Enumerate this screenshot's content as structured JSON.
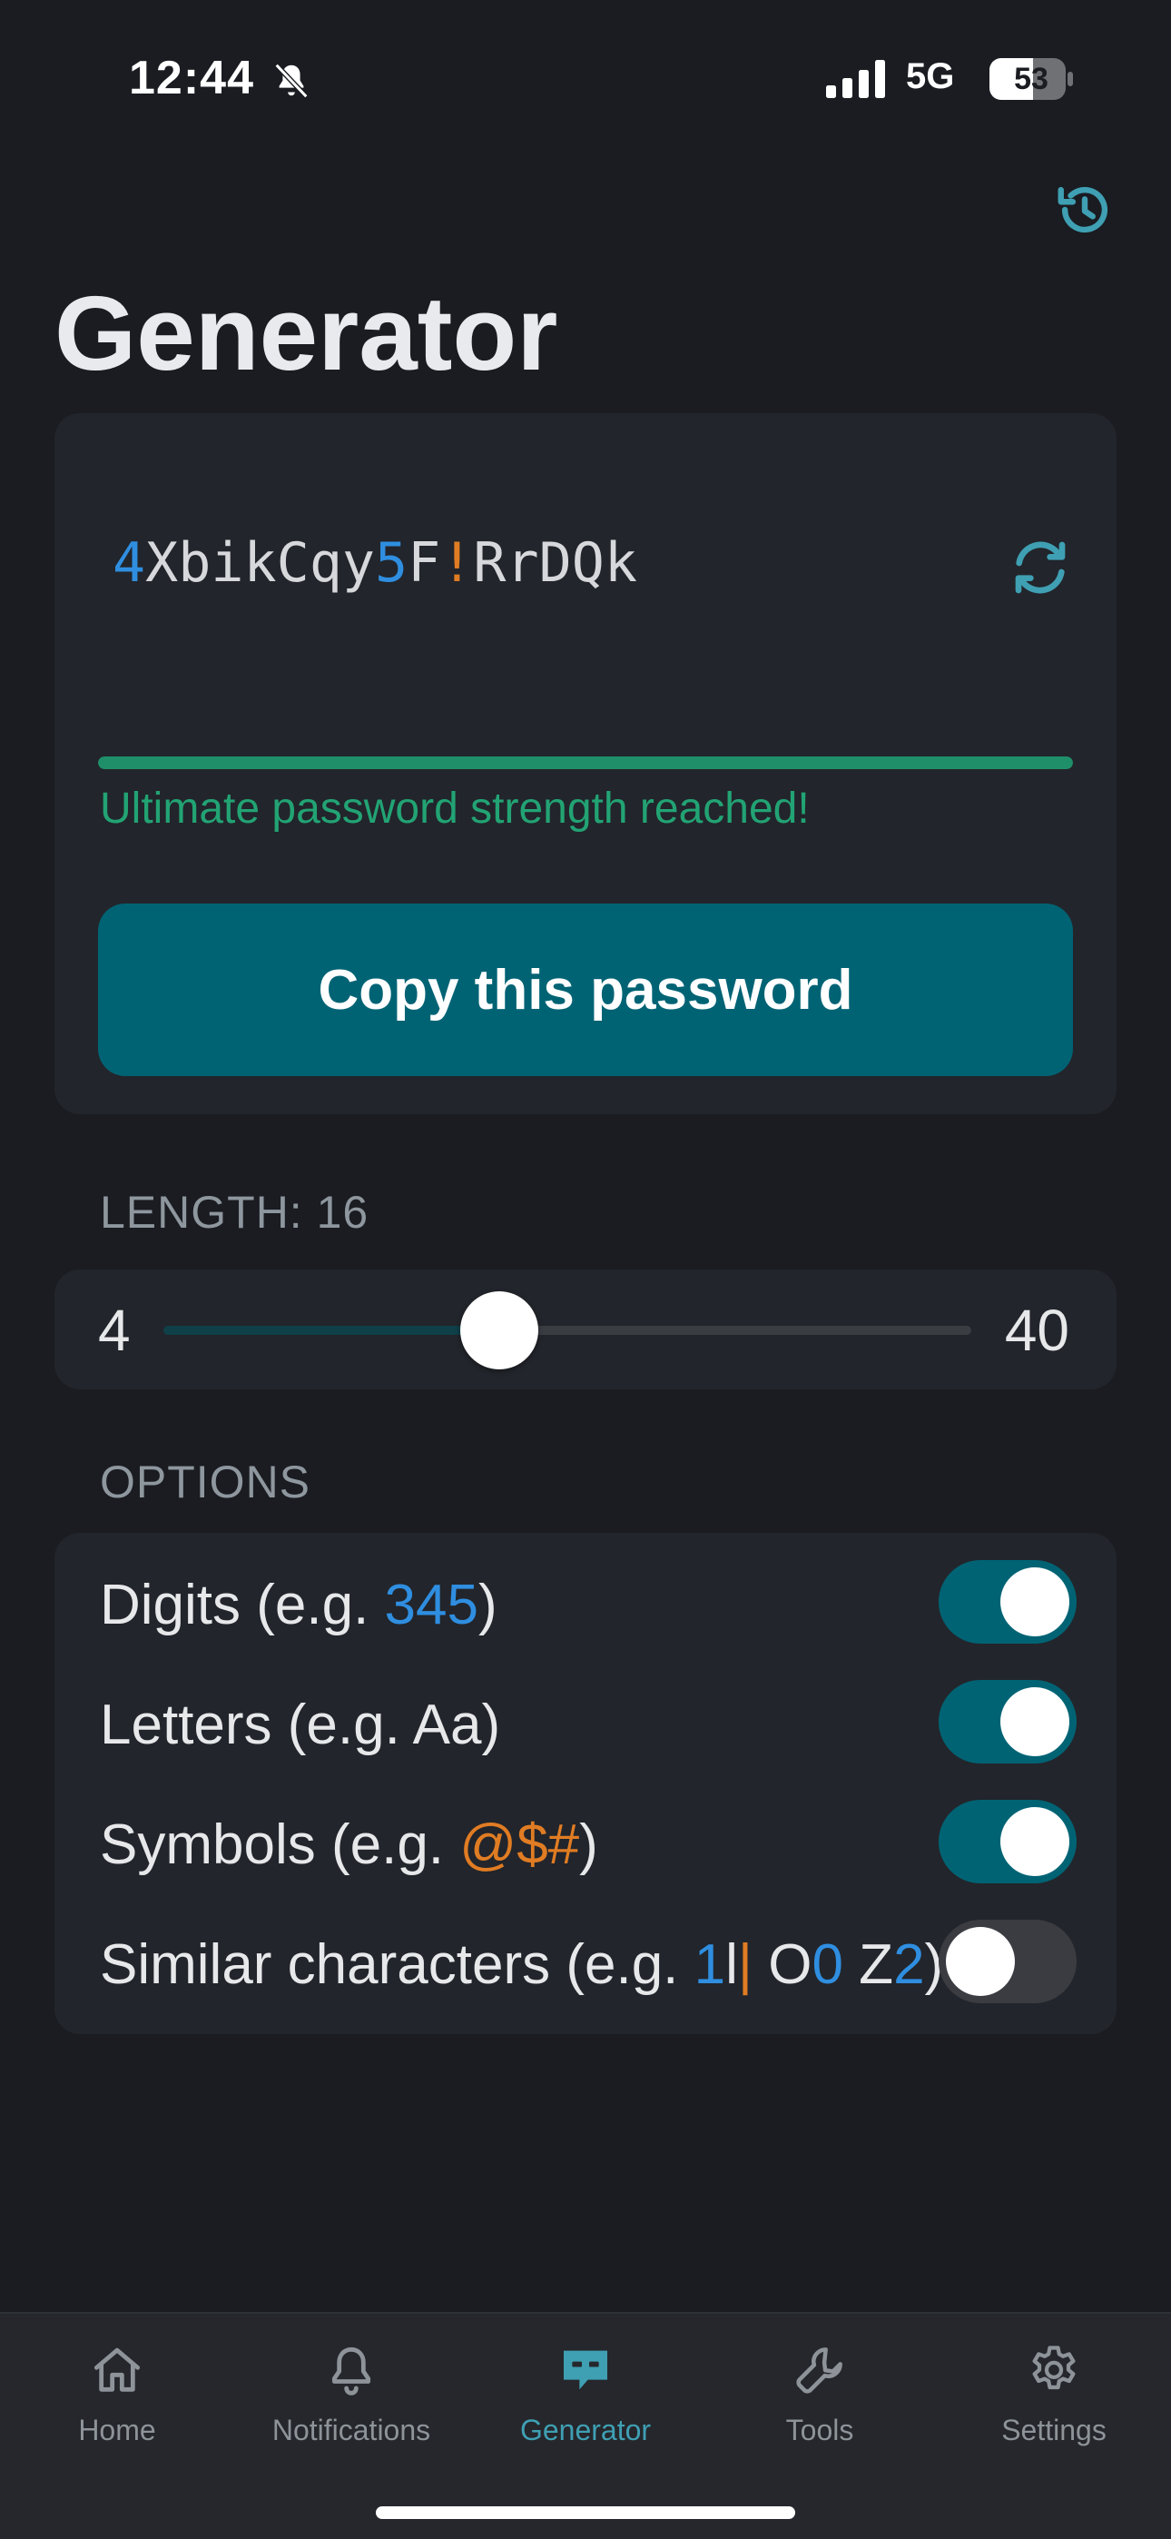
{
  "status_bar": {
    "time": "12:44",
    "network": "5G",
    "battery_level": "53"
  },
  "header": {
    "title": "Generator"
  },
  "password": {
    "characters": [
      {
        "ch": "4",
        "kind": "digit"
      },
      {
        "ch": "X",
        "kind": "letter"
      },
      {
        "ch": "b",
        "kind": "letter"
      },
      {
        "ch": "i",
        "kind": "letter"
      },
      {
        "ch": "k",
        "kind": "letter"
      },
      {
        "ch": "C",
        "kind": "letter"
      },
      {
        "ch": "q",
        "kind": "letter"
      },
      {
        "ch": "y",
        "kind": "letter"
      },
      {
        "ch": "5",
        "kind": "digit"
      },
      {
        "ch": "F",
        "kind": "letter"
      },
      {
        "ch": "!",
        "kind": "symbol"
      },
      {
        "ch": "R",
        "kind": "letter"
      },
      {
        "ch": "r",
        "kind": "letter"
      },
      {
        "ch": "D",
        "kind": "letter"
      },
      {
        "ch": "Q",
        "kind": "letter"
      },
      {
        "ch": "k",
        "kind": "letter"
      }
    ],
    "strength_percent": 100,
    "strength_message": "Ultimate password strength reached!",
    "copy_label": "Copy this password"
  },
  "length": {
    "label": "LENGTH: 16",
    "min_label": "4",
    "max_label": "40",
    "min": 4,
    "max": 40,
    "value": 16
  },
  "options": {
    "label": "OPTIONS",
    "items": [
      {
        "id": "digits",
        "segments": [
          {
            "t": "Digits (e.g. ",
            "k": "text"
          },
          {
            "t": "345",
            "k": "digit"
          },
          {
            "t": ")",
            "k": "text"
          }
        ],
        "enabled": true
      },
      {
        "id": "letters",
        "segments": [
          {
            "t": "Letters (e.g. Aa)",
            "k": "text"
          }
        ],
        "enabled": true
      },
      {
        "id": "symbols",
        "segments": [
          {
            "t": "Symbols (e.g. ",
            "k": "text"
          },
          {
            "t": "@$#",
            "k": "symbol"
          },
          {
            "t": ")",
            "k": "text"
          }
        ],
        "enabled": true
      },
      {
        "id": "similar",
        "segments": [
          {
            "t": "Similar characters (e.g. ",
            "k": "text"
          },
          {
            "t": "1",
            "k": "digit"
          },
          {
            "t": "l",
            "k": "text"
          },
          {
            "t": "|",
            "k": "symbol"
          },
          {
            "t": " O",
            "k": "text"
          },
          {
            "t": "0",
            "k": "digit"
          },
          {
            "t": " Z",
            "k": "text"
          },
          {
            "t": "2",
            "k": "digit"
          },
          {
            "t": ")",
            "k": "text"
          }
        ],
        "enabled": false
      }
    ]
  },
  "tabs": [
    {
      "label": "Home",
      "icon": "house-icon",
      "active": false
    },
    {
      "label": "Notifications",
      "icon": "bell-icon",
      "active": false
    },
    {
      "label": "Generator",
      "icon": "chat-dots-icon",
      "active": true
    },
    {
      "label": "Tools",
      "icon": "wrench-icon",
      "active": false
    },
    {
      "label": "Settings",
      "icon": "gear-icon",
      "active": false
    }
  ],
  "colors": {
    "background": "#1a1c21",
    "card": "#22252b",
    "accent": "#006374",
    "digit": "#2f8ee0",
    "symbol": "#e07c23",
    "strength": "#22a374",
    "active_tab": "#3f9fb3"
  }
}
